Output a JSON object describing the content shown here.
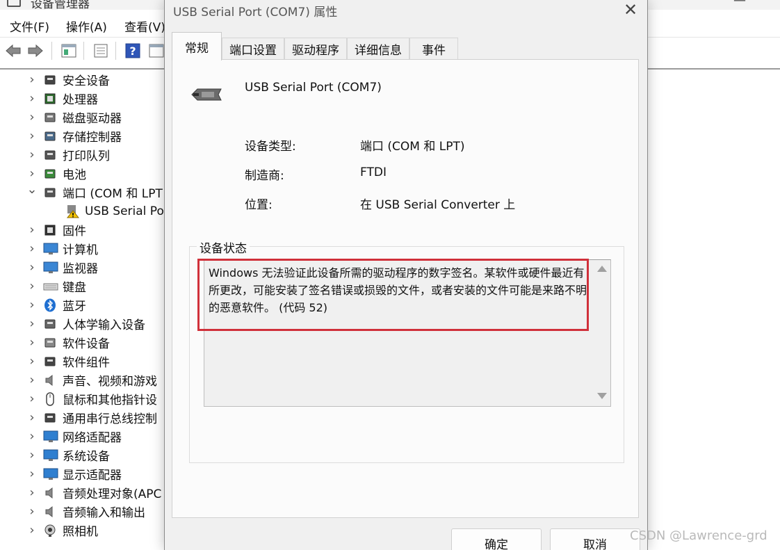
{
  "device_manager": {
    "menus": [
      "文件(F)",
      "操作(A)",
      "查看(V)"
    ],
    "tree": [
      {
        "label": "安全设备",
        "expanded": false,
        "icon": "security-device-icon"
      },
      {
        "label": "处理器",
        "expanded": false,
        "icon": "processor-icon"
      },
      {
        "label": "磁盘驱动器",
        "expanded": false,
        "icon": "disk-drive-icon"
      },
      {
        "label": "存储控制器",
        "expanded": false,
        "icon": "storage-controller-icon"
      },
      {
        "label": "打印队列",
        "expanded": false,
        "icon": "print-queue-icon"
      },
      {
        "label": "电池",
        "expanded": false,
        "icon": "battery-icon"
      },
      {
        "label": "端口 (COM 和 LPT",
        "expanded": true,
        "icon": "port-icon"
      },
      {
        "label": "USB Serial Por",
        "child": true,
        "icon": "warning-device-icon"
      },
      {
        "label": "固件",
        "expanded": false,
        "icon": "firmware-icon"
      },
      {
        "label": "计算机",
        "expanded": false,
        "icon": "computer-icon"
      },
      {
        "label": "监视器",
        "expanded": false,
        "icon": "monitor-icon"
      },
      {
        "label": "键盘",
        "expanded": false,
        "icon": "keyboard-icon"
      },
      {
        "label": "蓝牙",
        "expanded": false,
        "icon": "bluetooth-icon"
      },
      {
        "label": "人体学输入设备",
        "expanded": false,
        "icon": "hid-icon"
      },
      {
        "label": "软件设备",
        "expanded": false,
        "icon": "software-device-icon"
      },
      {
        "label": "软件组件",
        "expanded": false,
        "icon": "software-component-icon"
      },
      {
        "label": "声音、视频和游戏",
        "expanded": false,
        "icon": "sound-icon"
      },
      {
        "label": "鼠标和其他指针设",
        "expanded": false,
        "icon": "mouse-icon"
      },
      {
        "label": "通用串行总线控制",
        "expanded": false,
        "icon": "usb-controller-icon"
      },
      {
        "label": "网络适配器",
        "expanded": false,
        "icon": "network-adapter-icon"
      },
      {
        "label": "系统设备",
        "expanded": false,
        "icon": "system-device-icon"
      },
      {
        "label": "显示适配器",
        "expanded": false,
        "icon": "display-adapter-icon"
      },
      {
        "label": "音频处理对象(APC",
        "expanded": false,
        "icon": "audio-processing-icon"
      },
      {
        "label": "音频输入和输出",
        "expanded": false,
        "icon": "audio-io-icon"
      },
      {
        "label": "照相机",
        "expanded": false,
        "icon": "camera-icon"
      }
    ]
  },
  "dialog": {
    "title": "USB Serial Port (COM7) 属性",
    "close_glyph": "✕",
    "tabs": [
      "常规",
      "端口设置",
      "驱动程序",
      "详细信息",
      "事件"
    ],
    "active_tab": 0,
    "device_name": "USB Serial Port (COM7)",
    "properties": [
      {
        "label": "设备类型:",
        "value": "端口 (COM 和 LPT)"
      },
      {
        "label": "制造商:",
        "value": "FTDI"
      },
      {
        "label": "位置:",
        "value": "在 USB Serial Converter 上"
      }
    ],
    "status_legend": "设备状态",
    "status_text": "Windows 无法验证此设备所需的驱动程序的数字签名。某软件或硬件最近有所更改，可能安装了签名错误或损毁的文件，或者安装的文件可能是来路不明的恶意软件。 (代码 52)",
    "ok_label": "确定",
    "cancel_label": "取消",
    "highlight_color": "#d0303a"
  },
  "watermark": "CSDN @Lawrence-grd"
}
